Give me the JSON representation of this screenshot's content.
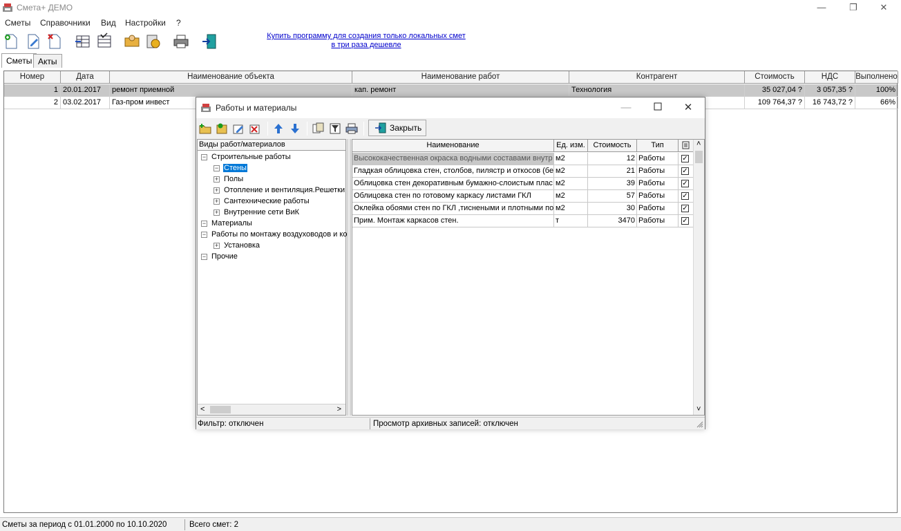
{
  "app": {
    "title": "Смета+ ДЕМО",
    "window_controls": {
      "minimize": "—",
      "restore": "❐",
      "close": "✕"
    }
  },
  "menu": [
    "Сметы",
    "Справочники",
    "Вид",
    "Настройки",
    "?"
  ],
  "toolbar": {
    "promo_line1": "Купить программу для создания только локальных смет",
    "promo_line2": "в три раза дешевле"
  },
  "tabs": [
    "Сметы",
    "Акты"
  ],
  "grid": {
    "columns": [
      "Номер",
      "Дата",
      "Наименование объекта",
      "Наименование работ",
      "Контрагент",
      "Стоимость",
      "НДС",
      "Выполнено"
    ],
    "rows": [
      {
        "num": "1",
        "date": "20.01.2017",
        "object": "ремонт приемной",
        "works": "кап. ремонт",
        "contractor": "Технология",
        "cost": "35 027,04 ?",
        "vat": "3 057,35 ?",
        "done": "100%"
      },
      {
        "num": "2",
        "date": "03.02.2017",
        "object": "Газ-пром инвест",
        "works": "",
        "contractor": "",
        "cost": "109 764,37 ?",
        "vat": "16 743,72 ?",
        "done": "66%"
      }
    ]
  },
  "statusbar": {
    "period": "Сметы за период с 01.01.2000 по 10.10.2020",
    "count": "Всего смет: 2"
  },
  "dialog": {
    "title": "Работы и материалы",
    "close_button": "Закрыть",
    "tree_header": "Виды работ/материалов",
    "tree": [
      {
        "label": "Строительные работы",
        "level": 0,
        "exp": "−"
      },
      {
        "label": "Стены",
        "level": 1,
        "exp": "−",
        "selected": true
      },
      {
        "label": "Полы",
        "level": 1,
        "exp": "+"
      },
      {
        "label": "Отопление и вентиляция.Решетки",
        "level": 1,
        "exp": "+"
      },
      {
        "label": "Сантехнические работы",
        "level": 1,
        "exp": "+"
      },
      {
        "label": "Внутренние сети ВиК",
        "level": 1,
        "exp": "+"
      },
      {
        "label": "Материалы",
        "level": 0,
        "exp": "−"
      },
      {
        "label": "Работы по монтажу воздуховодов и ко",
        "level": 0,
        "exp": "−"
      },
      {
        "label": "Установка",
        "level": 1,
        "exp": "+"
      },
      {
        "label": "Прочие",
        "level": 0,
        "exp": "−"
      }
    ],
    "list_columns": [
      "Наименование",
      "Ед. изм.",
      "Стоимость",
      "Тип"
    ],
    "list": [
      {
        "name": "Высококачественная окраска водными составами внутр",
        "unit": "м2",
        "cost": "12",
        "type": "Работы",
        "checked": "✓"
      },
      {
        "name": "Гладкая облицовка стен, столбов, пилястр и откосов (бе",
        "unit": "м2",
        "cost": "21",
        "type": "Работы",
        "checked": "✓"
      },
      {
        "name": "Облицовка стен декоративным бумажно-слоистым плас",
        "unit": "м2",
        "cost": "39",
        "type": "Работы",
        "checked": "✓"
      },
      {
        "name": "Облицовка стен по готовому каркасу листами ГКЛ",
        "unit": "м2",
        "cost": "57",
        "type": "Работы",
        "checked": "✓"
      },
      {
        "name": "Оклейка обоями стен по ГКЛ ,тиснеными и плотными по",
        "unit": "м2",
        "cost": "30",
        "type": "Работы",
        "checked": "✓"
      },
      {
        "name": "Прим. Монтаж каркасов стен.",
        "unit": "т",
        "cost": "3470",
        "type": "Работы",
        "checked": "✓"
      }
    ],
    "status_filter": "Фильтр: отключен",
    "status_archive": "Просмотр архивных записей: отключен",
    "scroll_glyphs": {
      "left": "<",
      "right": ">",
      "up": "˄",
      "down": "˅"
    }
  }
}
